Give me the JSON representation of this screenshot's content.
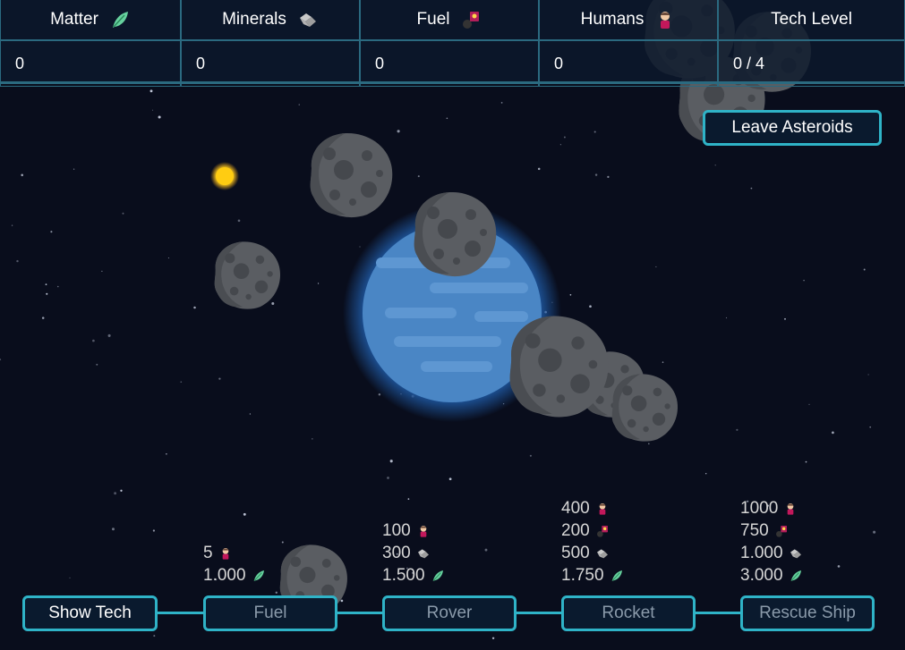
{
  "resources": [
    {
      "label": "Matter",
      "value": "0",
      "icon": "leaf-icon"
    },
    {
      "label": "Minerals",
      "value": "0",
      "icon": "minerals-icon"
    },
    {
      "label": "Fuel",
      "value": "0",
      "icon": "fuel-icon"
    },
    {
      "label": "Humans",
      "value": "0",
      "icon": "human-icon"
    },
    {
      "label": "Tech Level",
      "value": "0 / 4",
      "icon": ""
    }
  ],
  "leave_button": "Leave Asteroids",
  "tech": {
    "show_button": "Show Tech",
    "items": [
      {
        "label": "Fuel",
        "costs": [
          {
            "amount": "5",
            "icon": "human-icon"
          },
          {
            "amount": "1.000",
            "icon": "leaf-icon"
          }
        ]
      },
      {
        "label": "Rover",
        "costs": [
          {
            "amount": "100",
            "icon": "human-icon"
          },
          {
            "amount": "300",
            "icon": "minerals-icon"
          },
          {
            "amount": "1.500",
            "icon": "leaf-icon"
          }
        ]
      },
      {
        "label": "Rocket",
        "costs": [
          {
            "amount": "400",
            "icon": "human-icon"
          },
          {
            "amount": "200",
            "icon": "fuel-icon"
          },
          {
            "amount": "500",
            "icon": "minerals-icon"
          },
          {
            "amount": "1.750",
            "icon": "leaf-icon"
          }
        ]
      },
      {
        "label": "Rescue Ship",
        "costs": [
          {
            "amount": "1000",
            "icon": "human-icon"
          },
          {
            "amount": "750",
            "icon": "fuel-icon"
          },
          {
            "amount": "1.000",
            "icon": "minerals-icon"
          },
          {
            "amount": "3.000",
            "icon": "leaf-icon"
          }
        ]
      }
    ]
  },
  "colors": {
    "accent": "#2fb3c7",
    "background": "#090d1c",
    "planet": "#4a86c5",
    "asteroid": "#5b5e63",
    "sun": "#f7c21b"
  }
}
